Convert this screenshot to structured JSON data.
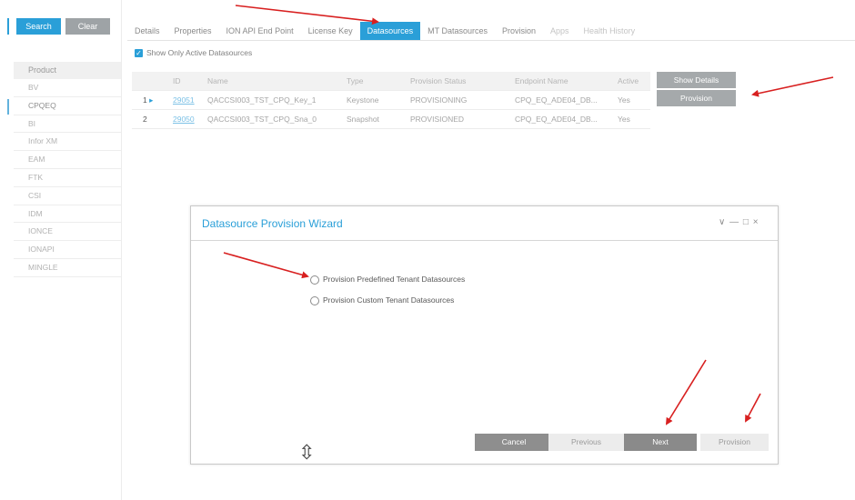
{
  "left": {
    "search_label": "Search",
    "clear_label": "Clear",
    "product_header": "Product",
    "products": [
      "BV",
      "CPQEQ",
      "BI",
      "Infor XM",
      "EAM",
      "FTK",
      "CSI",
      "IDM",
      "IONCE",
      "IONAPI",
      "MINGLE"
    ],
    "selected_product": "CPQEQ"
  },
  "tabs": [
    {
      "label": "Details",
      "state": "normal"
    },
    {
      "label": "Properties",
      "state": "normal"
    },
    {
      "label": "ION API End Point",
      "state": "normal"
    },
    {
      "label": "License Key",
      "state": "normal"
    },
    {
      "label": "Datasources",
      "state": "active"
    },
    {
      "label": "MT Datasources",
      "state": "normal"
    },
    {
      "label": "Provision",
      "state": "normal"
    },
    {
      "label": "Apps",
      "state": "dim"
    },
    {
      "label": "Health History",
      "state": "dim"
    }
  ],
  "filter": {
    "show_active_label": "Show Only Active Datasources",
    "checked": true
  },
  "table": {
    "headers": {
      "id": "ID",
      "name": "Name",
      "type": "Type",
      "status": "Provision Status",
      "endpoint": "Endpoint Name",
      "active": "Active"
    },
    "rows": [
      {
        "num": "1",
        "id": "29051",
        "name": "QACCSI003_TST_CPQ_Key_1",
        "type": "Keystone",
        "status": "PROVISIONING",
        "endpoint": "CPQ_EQ_ADE04_DB...",
        "active": "Yes"
      },
      {
        "num": "2",
        "id": "29050",
        "name": "QACCSI003_TST_CPQ_Sna_0",
        "type": "Snapshot",
        "status": "PROVISIONED",
        "endpoint": "CPQ_EQ_ADE04_DB...",
        "active": "Yes"
      }
    ]
  },
  "actions": {
    "show_details_label": "Show Details",
    "provision_label": "Provision"
  },
  "wizard": {
    "title": "Datasource Provision Wizard",
    "controls": "∨ — □ ×",
    "option1": "Provision Predefined Tenant Datasources",
    "option2": "Provision Custom Tenant Datasources",
    "cancel_label": "Cancel",
    "previous_label": "Previous",
    "next_label": "Next",
    "provision_label": "Provision"
  },
  "colors": {
    "accent": "#2a9fd8",
    "annotation_arrow": "#d82020",
    "button_gray": "#a5a9ab"
  },
  "icons": {
    "cursor": "resize-vertical-cursor-icon",
    "row_marker": "play-triangle-icon",
    "check": "checkmark-icon"
  }
}
